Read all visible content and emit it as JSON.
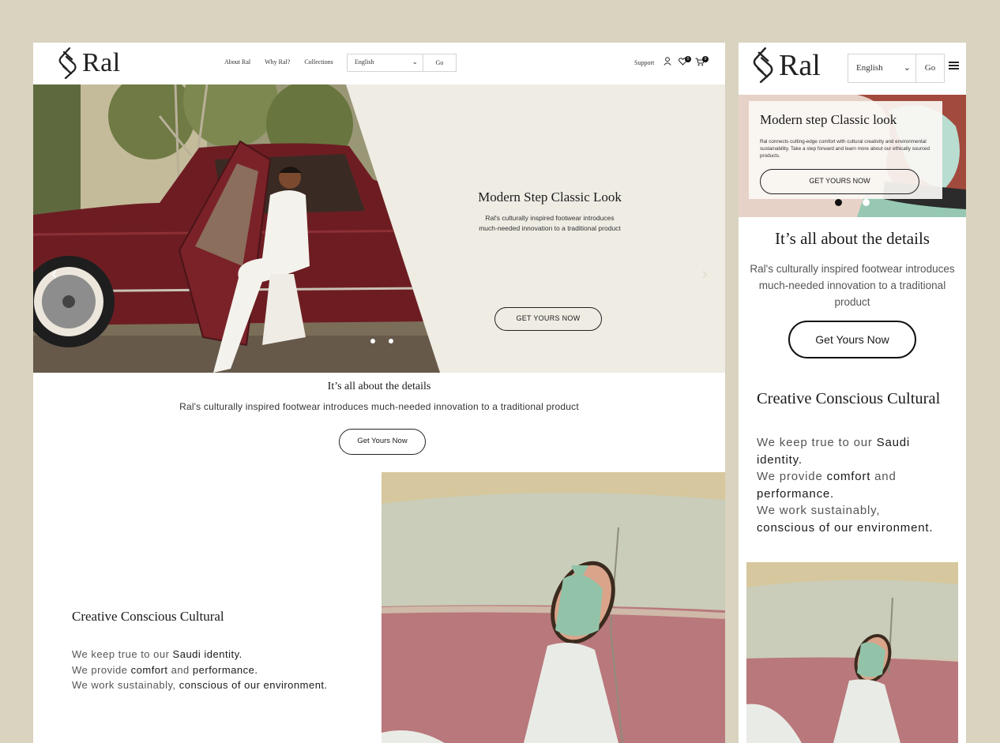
{
  "colors": {
    "page_background": "#d9d3bf",
    "hero_panel": "#efece4",
    "text_dark": "#1a1a1a",
    "text_muted": "#555555",
    "button_border": "#222222"
  },
  "brand": {
    "name": "Ral",
    "logo_icon": "ral-leaf-logo-icon"
  },
  "desktop": {
    "nav": [
      "About Ral",
      "Why Ral?",
      "Collections"
    ],
    "language": {
      "selected": "English",
      "go_label": "Go"
    },
    "support_label": "Support",
    "icons": {
      "account": "user-icon",
      "wishlist": "heart-icon",
      "cart": "cart-icon"
    },
    "wishlist_count": "0",
    "cart_count": "0",
    "hero": {
      "title": "Modern Step Classic Look",
      "subtitle": "Ral's culturally inspired footwear introduces much-needed innovation to a traditional product",
      "cta": "GET YOURS NOW",
      "prev_icon": "chevron-left-icon",
      "next_icon": "chevron-right-icon",
      "slide_count": 2
    },
    "details": {
      "title": "It’s all about the details",
      "subtitle": "Ral's culturally inspired footwear introduces much-needed innovation to a traditional product",
      "cta": "Get Yours Now"
    },
    "ccc": {
      "title": "Creative Conscious Cultural",
      "line1_pre": "We keep true to our ",
      "line1_em": "Saudi identity.",
      "line2_pre": "We provide ",
      "line2_em1": "comfort",
      "line2_mid": " and ",
      "line2_em2": "performance.",
      "line3_pre": "We work sustainably, ",
      "line3_em": "conscious of our environment."
    }
  },
  "mobile": {
    "language": {
      "selected": "English",
      "go_label": "Go"
    },
    "menu_icon": "hamburger-menu-icon",
    "hero": {
      "title": "Modern step Classic look",
      "subtitle": "Ral connects cutting-edge comfort with cultural creativity and environmental sustainability. Take a step forward and learn more about our ethically sourced products.",
      "cta": "GET YOURS NOW"
    },
    "details": {
      "title": "It’s all about the details",
      "subtitle": "Ral's culturally inspired footwear introduces much-needed innovation to a traditional product",
      "cta": "Get Yours Now"
    },
    "ccc": {
      "title": "Creative Conscious Cultural",
      "line1_pre": "We keep true to our ",
      "line1_em": "Saudi",
      "line1_em2": "identity.",
      "line2_pre": "We provide ",
      "line2_em1": "comfort",
      "line2_mid": " and",
      "line2_em2": "performance.",
      "line3_pre": "We work sustainably,",
      "line3_em": "conscious of our environment."
    }
  }
}
